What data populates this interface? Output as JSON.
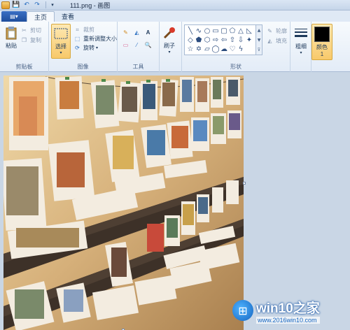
{
  "titlebar": {
    "title": "111.png - 画图"
  },
  "tabs": {
    "file_label": "",
    "home": "主页",
    "view": "查看"
  },
  "clipboard": {
    "paste": "粘贴",
    "cut": "剪切",
    "copy": "复制",
    "group": "剪贴板"
  },
  "image": {
    "select": "选择",
    "crop": "裁剪",
    "resize": "重新调整大小",
    "rotate": "旋转",
    "group": "图像"
  },
  "tools": {
    "group": "工具"
  },
  "brushes": {
    "label": "刷子"
  },
  "shapes": {
    "outline": "轮廓",
    "fill": "填充",
    "group": "形状"
  },
  "size": {
    "label": "粗细"
  },
  "colors": {
    "color1": "颜色 1",
    "color1_value": "#000000"
  },
  "watermark": {
    "title": "win10之家",
    "url": "www.2016win10.com"
  }
}
